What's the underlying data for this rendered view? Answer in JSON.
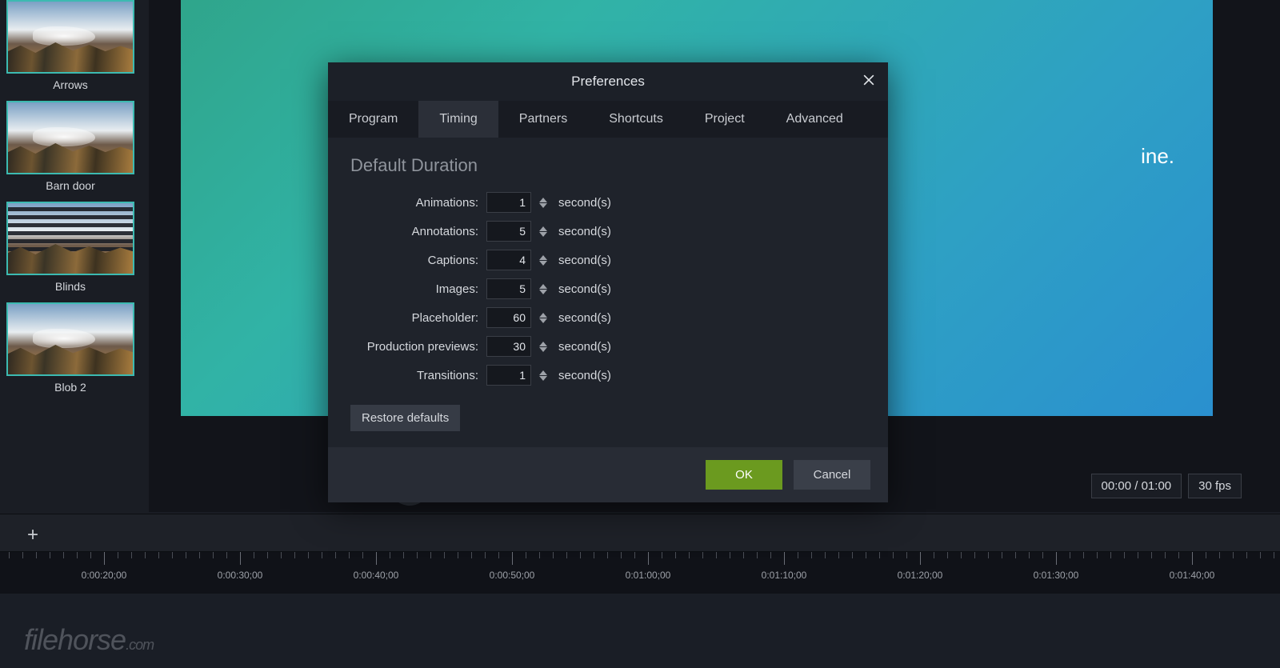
{
  "sidebar": {
    "items": [
      {
        "label": "Arrows"
      },
      {
        "label": "Barn door"
      },
      {
        "label": "Blinds"
      },
      {
        "label": "Blob 2"
      }
    ]
  },
  "canvas": {
    "partial_text": "ine."
  },
  "playback": {
    "time_readout": "00:00 / 01:00",
    "fps_readout": "30 fps"
  },
  "ruler": {
    "labels": [
      "0:00:20;00",
      "0:00:30;00",
      "0:00:40;00",
      "0:00:50;00",
      "0:01:00;00",
      "0:01:10;00",
      "0:01:20;00",
      "0:01:30;00",
      "0:01:40;00"
    ]
  },
  "dialog": {
    "title": "Preferences",
    "tabs": [
      "Program",
      "Timing",
      "Partners",
      "Shortcuts",
      "Project",
      "Advanced"
    ],
    "active_tab": 1,
    "section_heading": "Default Duration",
    "suffix": "second(s)",
    "fields": [
      {
        "label": "Animations:",
        "value": "1"
      },
      {
        "label": "Annotations:",
        "value": "5"
      },
      {
        "label": "Captions:",
        "value": "4"
      },
      {
        "label": "Images:",
        "value": "5"
      },
      {
        "label": "Placeholder:",
        "value": "60"
      },
      {
        "label": "Production previews:",
        "value": "30"
      },
      {
        "label": "Transitions:",
        "value": "1"
      }
    ],
    "restore": "Restore defaults",
    "ok": "OK",
    "cancel": "Cancel"
  },
  "watermark": {
    "brand": "filehorse",
    "tld": ".com"
  }
}
